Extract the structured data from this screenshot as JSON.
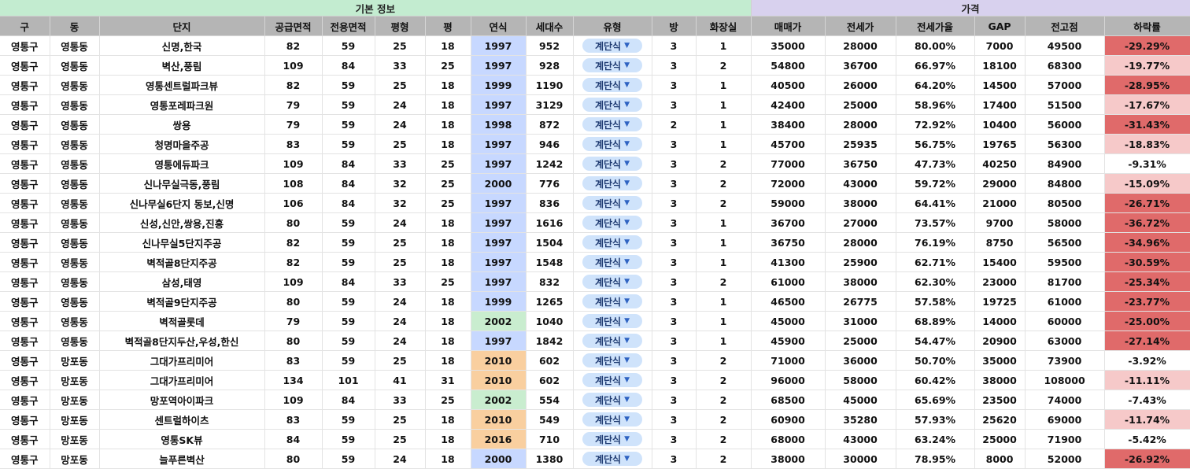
{
  "groups": {
    "basic": "기본 정보",
    "price": "가격"
  },
  "columns": [
    "구",
    "동",
    "단지",
    "공급면적",
    "전용면적",
    "평형",
    "평",
    "연식",
    "세대수",
    "유형",
    "방",
    "화장실",
    "매매가",
    "전세가",
    "전세가율",
    "GAP",
    "전고점",
    "하락률"
  ],
  "colors": {
    "year_blue": "#c7d8ff",
    "year_green": "#c9edcf",
    "year_orange": "#f9cf9f",
    "drop_strong": "#e06a6a",
    "drop_light": "#f6c9c9"
  },
  "dropdown_icon": "caret-down-icon",
  "rows": [
    {
      "gu": "영통구",
      "dong": "영통동",
      "complex": "신명,한국",
      "supply": "82",
      "exclusive": "59",
      "pyeong_type": "25",
      "pyeong": "18",
      "year": "1997",
      "year_color": "blue",
      "households": "952",
      "type": "계단식",
      "rooms": "3",
      "baths": "1",
      "sale": "35000",
      "jeonse": "28000",
      "ratio": "80.00%",
      "gap": "7000",
      "peak": "49500",
      "drop": "-29.29%",
      "drop_level": "strong"
    },
    {
      "gu": "영통구",
      "dong": "영통동",
      "complex": "벽산,풍림",
      "supply": "109",
      "exclusive": "84",
      "pyeong_type": "33",
      "pyeong": "25",
      "year": "1997",
      "year_color": "blue",
      "households": "928",
      "type": "계단식",
      "rooms": "3",
      "baths": "2",
      "sale": "54800",
      "jeonse": "36700",
      "ratio": "66.97%",
      "gap": "18100",
      "peak": "68300",
      "drop": "-19.77%",
      "drop_level": "light"
    },
    {
      "gu": "영통구",
      "dong": "영통동",
      "complex": "영통센트럴파크뷰",
      "supply": "82",
      "exclusive": "59",
      "pyeong_type": "25",
      "pyeong": "18",
      "year": "1999",
      "year_color": "blue",
      "households": "1190",
      "type": "계단식",
      "rooms": "3",
      "baths": "1",
      "sale": "40500",
      "jeonse": "26000",
      "ratio": "64.20%",
      "gap": "14500",
      "peak": "57000",
      "drop": "-28.95%",
      "drop_level": "strong"
    },
    {
      "gu": "영통구",
      "dong": "영통동",
      "complex": "영통포레파크원",
      "supply": "79",
      "exclusive": "59",
      "pyeong_type": "24",
      "pyeong": "18",
      "year": "1997",
      "year_color": "blue",
      "households": "3129",
      "type": "계단식",
      "rooms": "3",
      "baths": "1",
      "sale": "42400",
      "jeonse": "25000",
      "ratio": "58.96%",
      "gap": "17400",
      "peak": "51500",
      "drop": "-17.67%",
      "drop_level": "light"
    },
    {
      "gu": "영통구",
      "dong": "영통동",
      "complex": "쌍용",
      "supply": "79",
      "exclusive": "59",
      "pyeong_type": "24",
      "pyeong": "18",
      "year": "1998",
      "year_color": "blue",
      "households": "872",
      "type": "계단식",
      "rooms": "2",
      "baths": "1",
      "sale": "38400",
      "jeonse": "28000",
      "ratio": "72.92%",
      "gap": "10400",
      "peak": "56000",
      "drop": "-31.43%",
      "drop_level": "strong"
    },
    {
      "gu": "영통구",
      "dong": "영통동",
      "complex": "청명마을주공",
      "supply": "83",
      "exclusive": "59",
      "pyeong_type": "25",
      "pyeong": "18",
      "year": "1997",
      "year_color": "blue",
      "households": "946",
      "type": "계단식",
      "rooms": "3",
      "baths": "1",
      "sale": "45700",
      "jeonse": "25935",
      "ratio": "56.75%",
      "gap": "19765",
      "peak": "56300",
      "drop": "-18.83%",
      "drop_level": "light"
    },
    {
      "gu": "영통구",
      "dong": "영통동",
      "complex": "영통에듀파크",
      "supply": "109",
      "exclusive": "84",
      "pyeong_type": "33",
      "pyeong": "25",
      "year": "1997",
      "year_color": "blue",
      "households": "1242",
      "type": "계단식",
      "rooms": "3",
      "baths": "2",
      "sale": "77000",
      "jeonse": "36750",
      "ratio": "47.73%",
      "gap": "40250",
      "peak": "84900",
      "drop": "-9.31%",
      "drop_level": "none"
    },
    {
      "gu": "영통구",
      "dong": "영통동",
      "complex": "신나무실극동,풍림",
      "supply": "108",
      "exclusive": "84",
      "pyeong_type": "32",
      "pyeong": "25",
      "year": "2000",
      "year_color": "blue",
      "households": "776",
      "type": "계단식",
      "rooms": "3",
      "baths": "2",
      "sale": "72000",
      "jeonse": "43000",
      "ratio": "59.72%",
      "gap": "29000",
      "peak": "84800",
      "drop": "-15.09%",
      "drop_level": "light"
    },
    {
      "gu": "영통구",
      "dong": "영통동",
      "complex": "신나무실6단지 동보,신명",
      "supply": "106",
      "exclusive": "84",
      "pyeong_type": "32",
      "pyeong": "25",
      "year": "1997",
      "year_color": "blue",
      "households": "836",
      "type": "계단식",
      "rooms": "3",
      "baths": "2",
      "sale": "59000",
      "jeonse": "38000",
      "ratio": "64.41%",
      "gap": "21000",
      "peak": "80500",
      "drop": "-26.71%",
      "drop_level": "strong"
    },
    {
      "gu": "영통구",
      "dong": "영통동",
      "complex": "신성,신안,쌍용,진흥",
      "supply": "80",
      "exclusive": "59",
      "pyeong_type": "24",
      "pyeong": "18",
      "year": "1997",
      "year_color": "blue",
      "households": "1616",
      "type": "계단식",
      "rooms": "3",
      "baths": "1",
      "sale": "36700",
      "jeonse": "27000",
      "ratio": "73.57%",
      "gap": "9700",
      "peak": "58000",
      "drop": "-36.72%",
      "drop_level": "strong"
    },
    {
      "gu": "영통구",
      "dong": "영통동",
      "complex": "신나무실5단지주공",
      "supply": "82",
      "exclusive": "59",
      "pyeong_type": "25",
      "pyeong": "18",
      "year": "1997",
      "year_color": "blue",
      "households": "1504",
      "type": "계단식",
      "rooms": "3",
      "baths": "1",
      "sale": "36750",
      "jeonse": "28000",
      "ratio": "76.19%",
      "gap": "8750",
      "peak": "56500",
      "drop": "-34.96%",
      "drop_level": "strong"
    },
    {
      "gu": "영통구",
      "dong": "영통동",
      "complex": "벽적골8단지주공",
      "supply": "82",
      "exclusive": "59",
      "pyeong_type": "25",
      "pyeong": "18",
      "year": "1997",
      "year_color": "blue",
      "households": "1548",
      "type": "계단식",
      "rooms": "3",
      "baths": "1",
      "sale": "41300",
      "jeonse": "25900",
      "ratio": "62.71%",
      "gap": "15400",
      "peak": "59500",
      "drop": "-30.59%",
      "drop_level": "strong"
    },
    {
      "gu": "영통구",
      "dong": "영통동",
      "complex": "삼성,태영",
      "supply": "109",
      "exclusive": "84",
      "pyeong_type": "33",
      "pyeong": "25",
      "year": "1997",
      "year_color": "blue",
      "households": "832",
      "type": "계단식",
      "rooms": "3",
      "baths": "2",
      "sale": "61000",
      "jeonse": "38000",
      "ratio": "62.30%",
      "gap": "23000",
      "peak": "81700",
      "drop": "-25.34%",
      "drop_level": "strong"
    },
    {
      "gu": "영통구",
      "dong": "영통동",
      "complex": "벽적골9단지주공",
      "supply": "80",
      "exclusive": "59",
      "pyeong_type": "24",
      "pyeong": "18",
      "year": "1999",
      "year_color": "blue",
      "households": "1265",
      "type": "계단식",
      "rooms": "3",
      "baths": "1",
      "sale": "46500",
      "jeonse": "26775",
      "ratio": "57.58%",
      "gap": "19725",
      "peak": "61000",
      "drop": "-23.77%",
      "drop_level": "strong"
    },
    {
      "gu": "영통구",
      "dong": "영통동",
      "complex": "벽적골롯데",
      "supply": "79",
      "exclusive": "59",
      "pyeong_type": "24",
      "pyeong": "18",
      "year": "2002",
      "year_color": "green",
      "households": "1040",
      "type": "계단식",
      "rooms": "3",
      "baths": "1",
      "sale": "45000",
      "jeonse": "31000",
      "ratio": "68.89%",
      "gap": "14000",
      "peak": "60000",
      "drop": "-25.00%",
      "drop_level": "strong"
    },
    {
      "gu": "영통구",
      "dong": "영통동",
      "complex": "벽적골8단지두산,우성,한신",
      "supply": "80",
      "exclusive": "59",
      "pyeong_type": "24",
      "pyeong": "18",
      "year": "1997",
      "year_color": "blue",
      "households": "1842",
      "type": "계단식",
      "rooms": "3",
      "baths": "1",
      "sale": "45900",
      "jeonse": "25000",
      "ratio": "54.47%",
      "gap": "20900",
      "peak": "63000",
      "drop": "-27.14%",
      "drop_level": "strong"
    },
    {
      "gu": "영통구",
      "dong": "망포동",
      "complex": "그대가프리미어",
      "supply": "83",
      "exclusive": "59",
      "pyeong_type": "25",
      "pyeong": "18",
      "year": "2010",
      "year_color": "orange",
      "households": "602",
      "type": "계단식",
      "rooms": "3",
      "baths": "2",
      "sale": "71000",
      "jeonse": "36000",
      "ratio": "50.70%",
      "gap": "35000",
      "peak": "73900",
      "drop": "-3.92%",
      "drop_level": "none"
    },
    {
      "gu": "영통구",
      "dong": "망포동",
      "complex": "그대가프리미어",
      "supply": "134",
      "exclusive": "101",
      "pyeong_type": "41",
      "pyeong": "31",
      "year": "2010",
      "year_color": "orange",
      "households": "602",
      "type": "계단식",
      "rooms": "3",
      "baths": "2",
      "sale": "96000",
      "jeonse": "58000",
      "ratio": "60.42%",
      "gap": "38000",
      "peak": "108000",
      "drop": "-11.11%",
      "drop_level": "light"
    },
    {
      "gu": "영통구",
      "dong": "망포동",
      "complex": "망포역아이파크",
      "supply": "109",
      "exclusive": "84",
      "pyeong_type": "33",
      "pyeong": "25",
      "year": "2002",
      "year_color": "green",
      "households": "554",
      "type": "계단식",
      "rooms": "3",
      "baths": "2",
      "sale": "68500",
      "jeonse": "45000",
      "ratio": "65.69%",
      "gap": "23500",
      "peak": "74000",
      "drop": "-7.43%",
      "drop_level": "none"
    },
    {
      "gu": "영통구",
      "dong": "망포동",
      "complex": "센트럴하이츠",
      "supply": "83",
      "exclusive": "59",
      "pyeong_type": "25",
      "pyeong": "18",
      "year": "2010",
      "year_color": "orange",
      "households": "549",
      "type": "계단식",
      "rooms": "3",
      "baths": "2",
      "sale": "60900",
      "jeonse": "35280",
      "ratio": "57.93%",
      "gap": "25620",
      "peak": "69000",
      "drop": "-11.74%",
      "drop_level": "light"
    },
    {
      "gu": "영통구",
      "dong": "망포동",
      "complex": "영통SK뷰",
      "supply": "84",
      "exclusive": "59",
      "pyeong_type": "25",
      "pyeong": "18",
      "year": "2016",
      "year_color": "orange",
      "households": "710",
      "type": "계단식",
      "rooms": "3",
      "baths": "2",
      "sale": "68000",
      "jeonse": "43000",
      "ratio": "63.24%",
      "gap": "25000",
      "peak": "71900",
      "drop": "-5.42%",
      "drop_level": "none"
    },
    {
      "gu": "영통구",
      "dong": "망포동",
      "complex": "늘푸른벽산",
      "supply": "80",
      "exclusive": "59",
      "pyeong_type": "24",
      "pyeong": "18",
      "year": "2000",
      "year_color": "blue",
      "households": "1380",
      "type": "계단식",
      "rooms": "3",
      "baths": "2",
      "sale": "38000",
      "jeonse": "30000",
      "ratio": "78.95%",
      "gap": "8000",
      "peak": "52000",
      "drop": "-26.92%",
      "drop_level": "strong"
    }
  ]
}
